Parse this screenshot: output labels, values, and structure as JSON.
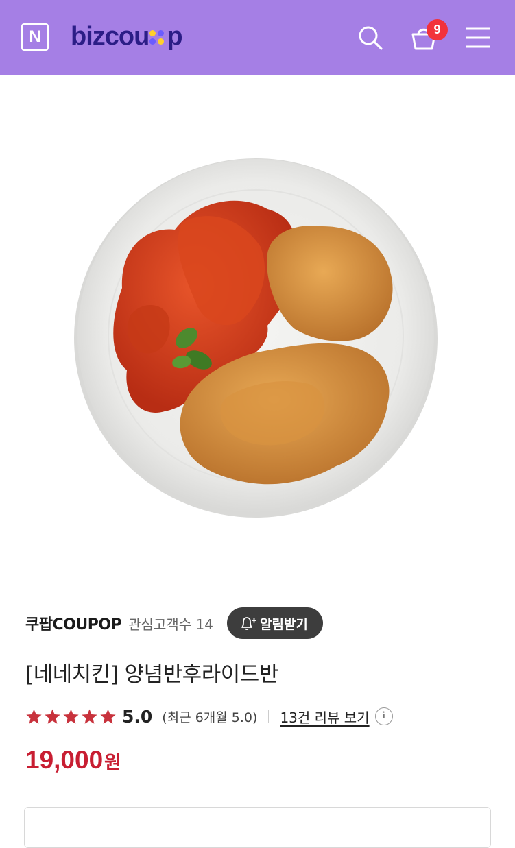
{
  "header": {
    "n_logo": "N",
    "brand_parts": [
      "bizcou",
      "p"
    ],
    "cart_count": "9",
    "icons": {
      "search": "search-icon",
      "cart": "cart-icon",
      "menu": "hamburger-menu-icon"
    },
    "colors": {
      "bar": "#a57fe5",
      "brand": "#2b1d86",
      "badge": "#f2323a"
    }
  },
  "product": {
    "image": "fried-chicken-plate",
    "seller_name": "쿠팝COUPOP",
    "followers": "관심고객수 14",
    "notify_label": "알림받기",
    "title": "[네네치킨] 양념반후라이드반",
    "rating": {
      "stars": 5,
      "score": "5.0",
      "recent": "(최근 6개월 5.0)",
      "review_link": "13건 리뷰 보기"
    },
    "price": "19,000",
    "currency": "원",
    "colors": {
      "price": "#c81e32",
      "star": "#c8323c"
    }
  }
}
